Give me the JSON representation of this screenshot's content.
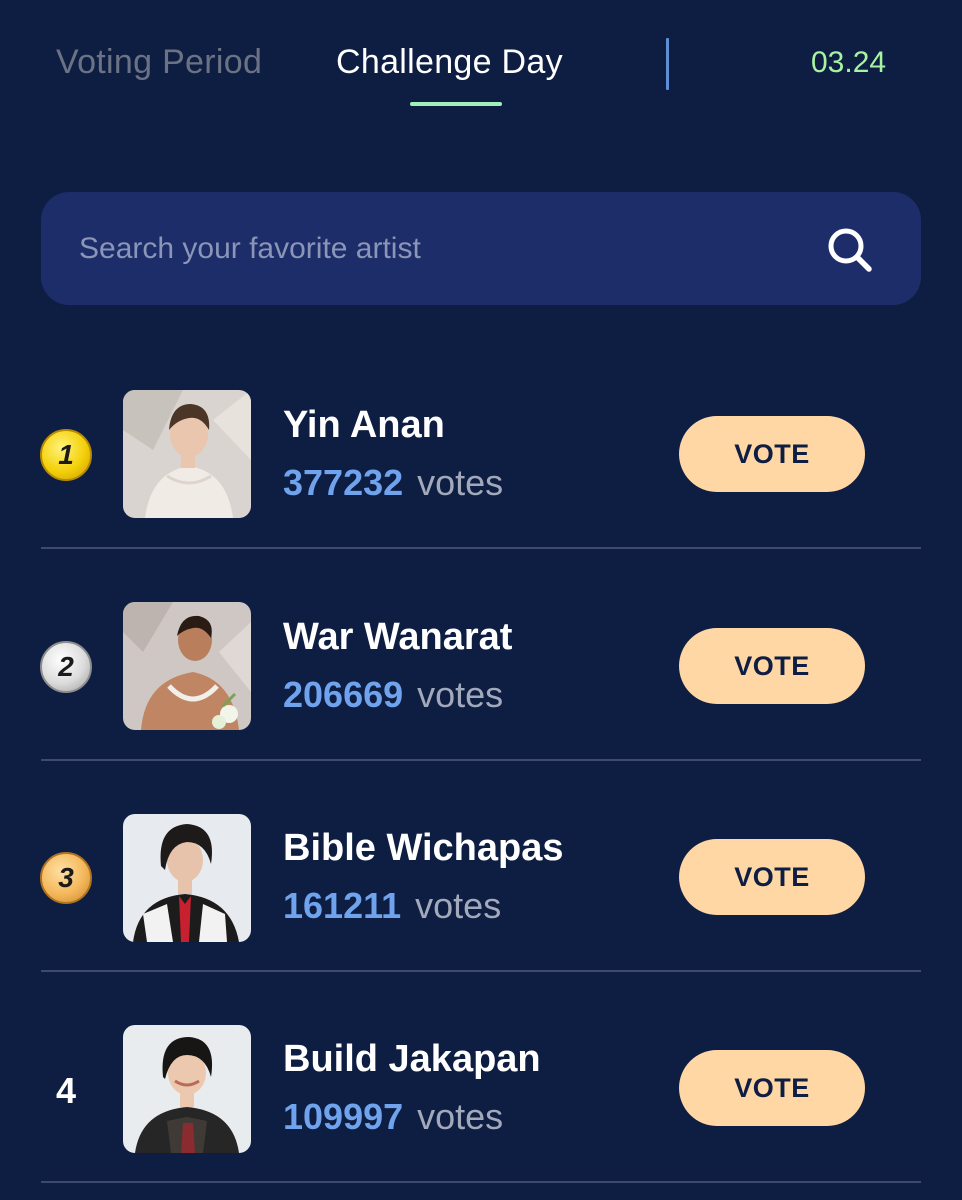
{
  "tabs": {
    "voting_period": "Voting Period",
    "challenge_day": "Challenge Day",
    "active": "challenge_day"
  },
  "date": "03.24",
  "search": {
    "placeholder": "Search your favorite artist",
    "value": "",
    "icon": "search-icon"
  },
  "ranking": [
    {
      "rank": "1",
      "badge": "gold-medal",
      "name": "Yin Anan",
      "votes": "377232",
      "votes_unit": "votes",
      "button_label": "VOTE"
    },
    {
      "rank": "2",
      "badge": "silver-medal",
      "name": "War Wanarat",
      "votes": "206669",
      "votes_unit": "votes",
      "button_label": "VOTE"
    },
    {
      "rank": "3",
      "badge": "bronze-medal",
      "name": "Bible Wichapas",
      "votes": "161211",
      "votes_unit": "votes",
      "button_label": "VOTE"
    },
    {
      "rank": "4",
      "badge": "none",
      "name": "Build Jakapan",
      "votes": "109997",
      "votes_unit": "votes",
      "button_label": "VOTE"
    }
  ],
  "colors": {
    "background": "#0e1d42",
    "search_bg": "#1c2d69",
    "accent_green": "#9ff0b8",
    "date_color": "#a7f3a2",
    "votes_blue": "#6fa3ee",
    "vote_button": "#ffd7a5",
    "inactive_tab": "#6b7283"
  }
}
